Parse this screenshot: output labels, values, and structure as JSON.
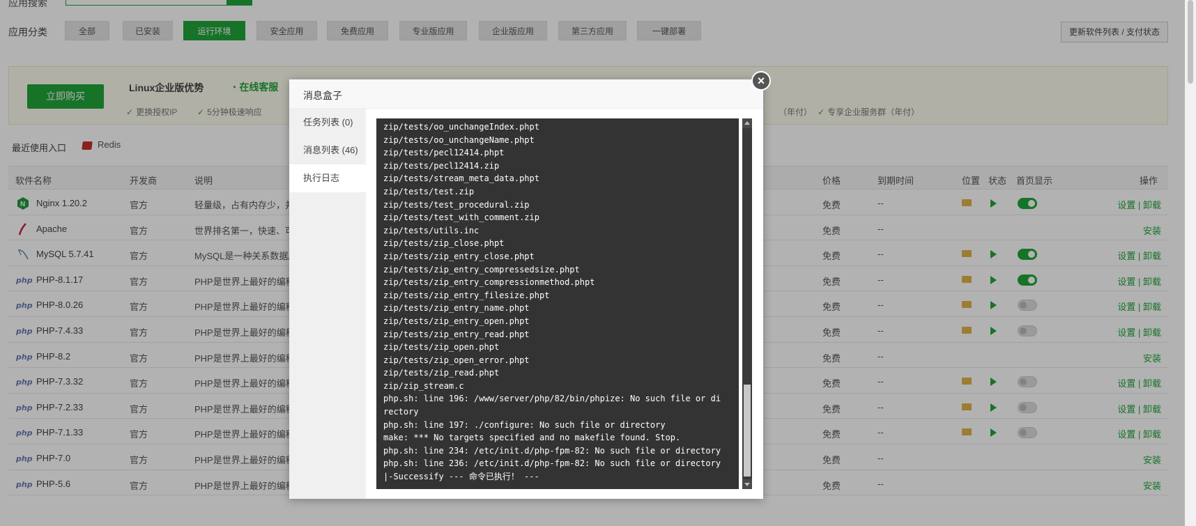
{
  "search": {
    "label": "应用搜索"
  },
  "categories": {
    "label": "应用分类",
    "items": [
      "全部",
      "已安装",
      "运行环境",
      "安全应用",
      "免费应用",
      "专业版应用",
      "企业版应用",
      "第三方应用",
      "一键部署"
    ],
    "active": "运行环境"
  },
  "refresh_button": "更新软件列表 / 支付状态",
  "promo": {
    "buy_button": "立即购买",
    "title": "Linux企业版优势",
    "service": "在线客服",
    "features": [
      "更换授权IP",
      "5分钟极速响应",
      "（年付）",
      "专享企业服务群（年付）"
    ]
  },
  "recent": {
    "label": "最近使用入口",
    "items": [
      "Redis"
    ]
  },
  "table": {
    "headers": [
      "软件名称",
      "开发商",
      "说明",
      "价格",
      "到期时间",
      "位置",
      "状态",
      "首页显示",
      "操作"
    ],
    "rows": [
      {
        "name": "Nginx 1.20.2",
        "vendor": "官方",
        "desc": "轻量级，占有内存少，并发",
        "price": "免费",
        "expire": "--",
        "ops": "设置 | 卸载",
        "installed": true,
        "home": true,
        "icon": "nginx-icon"
      },
      {
        "name": "Apache",
        "vendor": "官方",
        "desc": "世界排名第一，快速、可靠",
        "price": "免费",
        "expire": "--",
        "ops": "安装",
        "installed": false,
        "home": false,
        "icon": "apache-icon"
      },
      {
        "name": "MySQL 5.7.41",
        "vendor": "官方",
        "desc": "MySQL是一种关系数据库",
        "price": "免费",
        "expire": "--",
        "ops": "设置 | 卸载",
        "installed": true,
        "home": true,
        "icon": "mysql-icon"
      },
      {
        "name": "PHP-8.1.17",
        "vendor": "官方",
        "desc": "PHP是世界上最好的编程语",
        "price": "免费",
        "expire": "--",
        "ops": "设置 | 卸载",
        "installed": true,
        "home": true,
        "icon": "php-icon"
      },
      {
        "name": "PHP-8.0.26",
        "vendor": "官方",
        "desc": "PHP是世界上最好的编程语",
        "price": "免费",
        "expire": "--",
        "ops": "设置 | 卸载",
        "installed": true,
        "home": false,
        "icon": "php-icon"
      },
      {
        "name": "PHP-7.4.33",
        "vendor": "官方",
        "desc": "PHP是世界上最好的编程语",
        "price": "免费",
        "expire": "--",
        "ops": "设置 | 卸载",
        "installed": true,
        "home": false,
        "icon": "php-icon"
      },
      {
        "name": "PHP-8.2",
        "vendor": "官方",
        "desc": "PHP是世界上最好的编程语",
        "price": "免费",
        "expire": "--",
        "ops": "安装",
        "installed": false,
        "home": false,
        "icon": "php-icon"
      },
      {
        "name": "PHP-7.3.32",
        "vendor": "官方",
        "desc": "PHP是世界上最好的编程语",
        "price": "免费",
        "expire": "--",
        "ops": "设置 | 卸载",
        "installed": true,
        "home": false,
        "icon": "php-icon"
      },
      {
        "name": "PHP-7.2.33",
        "vendor": "官方",
        "desc": "PHP是世界上最好的编程语",
        "price": "免费",
        "expire": "--",
        "ops": "设置 | 卸载",
        "installed": true,
        "home": false,
        "icon": "php-icon"
      },
      {
        "name": "PHP-7.1.33",
        "vendor": "官方",
        "desc": "PHP是世界上最好的编程语",
        "price": "免费",
        "expire": "--",
        "ops": "设置 | 卸载",
        "installed": true,
        "home": false,
        "icon": "php-icon"
      },
      {
        "name": "PHP-7.0",
        "vendor": "官方",
        "desc": "PHP是世界上最好的编程语",
        "price": "免费",
        "expire": "--",
        "ops": "安装",
        "installed": false,
        "home": false,
        "icon": "php-icon"
      },
      {
        "name": "PHP-5.6",
        "vendor": "官方",
        "desc": "PHP是世界上最好的编程语言",
        "price": "免费",
        "expire": "--",
        "ops": "安装",
        "installed": false,
        "home": false,
        "icon": "php-icon"
      }
    ]
  },
  "modal": {
    "title": "消息盒子",
    "close": "×",
    "tabs": [
      "任务列表 (0)",
      "消息列表 (46)",
      "执行日志"
    ],
    "active_tab": "执行日志",
    "log_lines": [
      "zip/tests/oo_unchangeIndex.phpt",
      "zip/tests/oo_unchangeName.phpt",
      "zip/tests/pecl12414.phpt",
      "zip/tests/pecl12414.zip",
      "zip/tests/stream_meta_data.phpt",
      "zip/tests/test.zip",
      "zip/tests/test_procedural.zip",
      "zip/tests/test_with_comment.zip",
      "zip/tests/utils.inc",
      "zip/tests/zip_close.phpt",
      "zip/tests/zip_entry_close.phpt",
      "zip/tests/zip_entry_compressedsize.phpt",
      "zip/tests/zip_entry_compressionmethod.phpt",
      "zip/tests/zip_entry_filesize.phpt",
      "zip/tests/zip_entry_name.phpt",
      "zip/tests/zip_entry_open.phpt",
      "zip/tests/zip_entry_read.phpt",
      "zip/tests/zip_open.phpt",
      "zip/tests/zip_open_error.phpt",
      "zip/tests/zip_read.phpt",
      "zip/zip_stream.c",
      "php.sh: line 196: /www/server/php/82/bin/phpize: No such file or directory",
      "php.sh: line 197: ./configure: No such file or directory",
      "make: *** No targets specified and no makefile found. Stop.",
      "php.sh: line 234: /etc/init.d/php-fpm-82: No such file or directory",
      "php.sh: line 236: /etc/init.d/php-fpm-82: No such file or directory",
      "|-Successify --- 命令已执行！ ---"
    ]
  },
  "colors": {
    "accent": "#20a53a",
    "console_bg": "#333333",
    "folder": "#e0b34a"
  }
}
